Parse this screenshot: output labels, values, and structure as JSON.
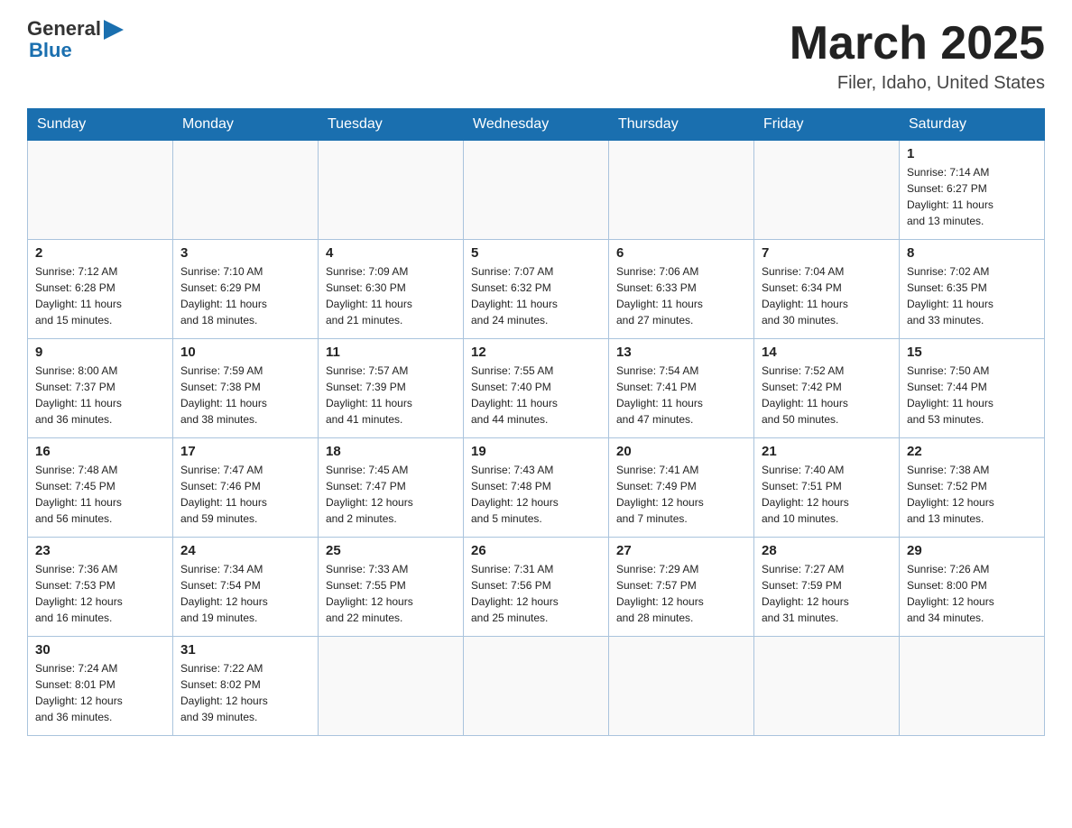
{
  "header": {
    "logo": {
      "general": "General",
      "arrow": "▶",
      "blue": "Blue"
    },
    "month": "March 2025",
    "location": "Filer, Idaho, United States"
  },
  "days_header": [
    "Sunday",
    "Monday",
    "Tuesday",
    "Wednesday",
    "Thursday",
    "Friday",
    "Saturday"
  ],
  "weeks": [
    [
      {
        "day": "",
        "info": ""
      },
      {
        "day": "",
        "info": ""
      },
      {
        "day": "",
        "info": ""
      },
      {
        "day": "",
        "info": ""
      },
      {
        "day": "",
        "info": ""
      },
      {
        "day": "",
        "info": ""
      },
      {
        "day": "1",
        "info": "Sunrise: 7:14 AM\nSunset: 6:27 PM\nDaylight: 11 hours\nand 13 minutes."
      }
    ],
    [
      {
        "day": "2",
        "info": "Sunrise: 7:12 AM\nSunset: 6:28 PM\nDaylight: 11 hours\nand 15 minutes."
      },
      {
        "day": "3",
        "info": "Sunrise: 7:10 AM\nSunset: 6:29 PM\nDaylight: 11 hours\nand 18 minutes."
      },
      {
        "day": "4",
        "info": "Sunrise: 7:09 AM\nSunset: 6:30 PM\nDaylight: 11 hours\nand 21 minutes."
      },
      {
        "day": "5",
        "info": "Sunrise: 7:07 AM\nSunset: 6:32 PM\nDaylight: 11 hours\nand 24 minutes."
      },
      {
        "day": "6",
        "info": "Sunrise: 7:06 AM\nSunset: 6:33 PM\nDaylight: 11 hours\nand 27 minutes."
      },
      {
        "day": "7",
        "info": "Sunrise: 7:04 AM\nSunset: 6:34 PM\nDaylight: 11 hours\nand 30 minutes."
      },
      {
        "day": "8",
        "info": "Sunrise: 7:02 AM\nSunset: 6:35 PM\nDaylight: 11 hours\nand 33 minutes."
      }
    ],
    [
      {
        "day": "9",
        "info": "Sunrise: 8:00 AM\nSunset: 7:37 PM\nDaylight: 11 hours\nand 36 minutes."
      },
      {
        "day": "10",
        "info": "Sunrise: 7:59 AM\nSunset: 7:38 PM\nDaylight: 11 hours\nand 38 minutes."
      },
      {
        "day": "11",
        "info": "Sunrise: 7:57 AM\nSunset: 7:39 PM\nDaylight: 11 hours\nand 41 minutes."
      },
      {
        "day": "12",
        "info": "Sunrise: 7:55 AM\nSunset: 7:40 PM\nDaylight: 11 hours\nand 44 minutes."
      },
      {
        "day": "13",
        "info": "Sunrise: 7:54 AM\nSunset: 7:41 PM\nDaylight: 11 hours\nand 47 minutes."
      },
      {
        "day": "14",
        "info": "Sunrise: 7:52 AM\nSunset: 7:42 PM\nDaylight: 11 hours\nand 50 minutes."
      },
      {
        "day": "15",
        "info": "Sunrise: 7:50 AM\nSunset: 7:44 PM\nDaylight: 11 hours\nand 53 minutes."
      }
    ],
    [
      {
        "day": "16",
        "info": "Sunrise: 7:48 AM\nSunset: 7:45 PM\nDaylight: 11 hours\nand 56 minutes."
      },
      {
        "day": "17",
        "info": "Sunrise: 7:47 AM\nSunset: 7:46 PM\nDaylight: 11 hours\nand 59 minutes."
      },
      {
        "day": "18",
        "info": "Sunrise: 7:45 AM\nSunset: 7:47 PM\nDaylight: 12 hours\nand 2 minutes."
      },
      {
        "day": "19",
        "info": "Sunrise: 7:43 AM\nSunset: 7:48 PM\nDaylight: 12 hours\nand 5 minutes."
      },
      {
        "day": "20",
        "info": "Sunrise: 7:41 AM\nSunset: 7:49 PM\nDaylight: 12 hours\nand 7 minutes."
      },
      {
        "day": "21",
        "info": "Sunrise: 7:40 AM\nSunset: 7:51 PM\nDaylight: 12 hours\nand 10 minutes."
      },
      {
        "day": "22",
        "info": "Sunrise: 7:38 AM\nSunset: 7:52 PM\nDaylight: 12 hours\nand 13 minutes."
      }
    ],
    [
      {
        "day": "23",
        "info": "Sunrise: 7:36 AM\nSunset: 7:53 PM\nDaylight: 12 hours\nand 16 minutes."
      },
      {
        "day": "24",
        "info": "Sunrise: 7:34 AM\nSunset: 7:54 PM\nDaylight: 12 hours\nand 19 minutes."
      },
      {
        "day": "25",
        "info": "Sunrise: 7:33 AM\nSunset: 7:55 PM\nDaylight: 12 hours\nand 22 minutes."
      },
      {
        "day": "26",
        "info": "Sunrise: 7:31 AM\nSunset: 7:56 PM\nDaylight: 12 hours\nand 25 minutes."
      },
      {
        "day": "27",
        "info": "Sunrise: 7:29 AM\nSunset: 7:57 PM\nDaylight: 12 hours\nand 28 minutes."
      },
      {
        "day": "28",
        "info": "Sunrise: 7:27 AM\nSunset: 7:59 PM\nDaylight: 12 hours\nand 31 minutes."
      },
      {
        "day": "29",
        "info": "Sunrise: 7:26 AM\nSunset: 8:00 PM\nDaylight: 12 hours\nand 34 minutes."
      }
    ],
    [
      {
        "day": "30",
        "info": "Sunrise: 7:24 AM\nSunset: 8:01 PM\nDaylight: 12 hours\nand 36 minutes."
      },
      {
        "day": "31",
        "info": "Sunrise: 7:22 AM\nSunset: 8:02 PM\nDaylight: 12 hours\nand 39 minutes."
      },
      {
        "day": "",
        "info": ""
      },
      {
        "day": "",
        "info": ""
      },
      {
        "day": "",
        "info": ""
      },
      {
        "day": "",
        "info": ""
      },
      {
        "day": "",
        "info": ""
      }
    ]
  ]
}
